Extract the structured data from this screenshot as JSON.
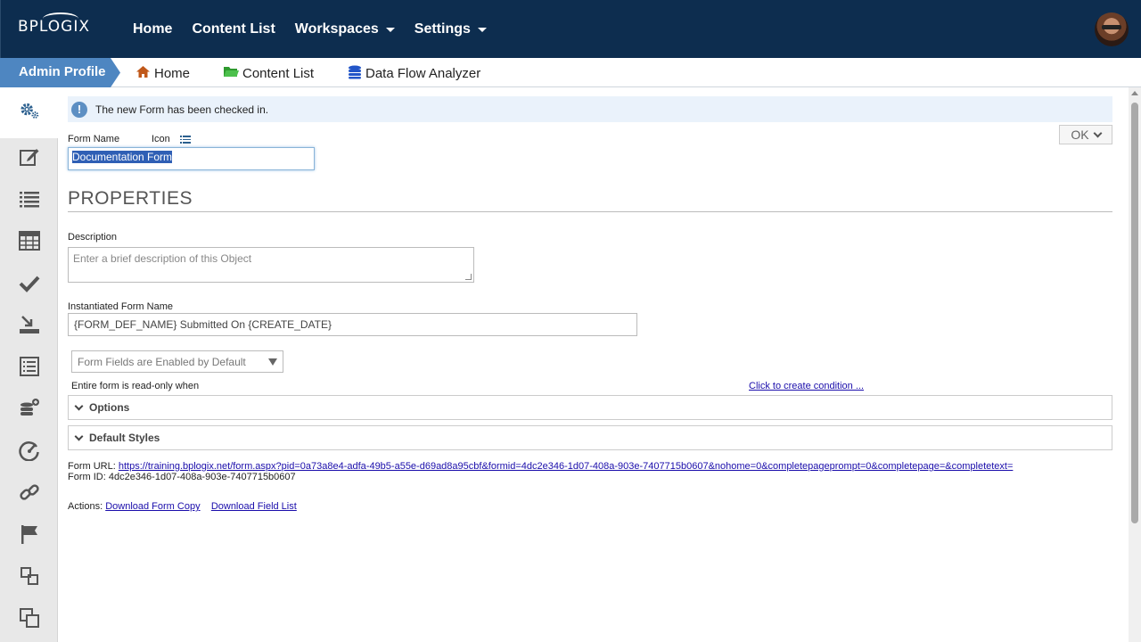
{
  "topbar": {
    "logo": "BPLOGIX",
    "nav": [
      {
        "label": "Home",
        "dropdown": false
      },
      {
        "label": "Content List",
        "dropdown": false
      },
      {
        "label": "Workspaces",
        "dropdown": true
      },
      {
        "label": "Settings",
        "dropdown": true
      }
    ],
    "avatar": "user-avatar"
  },
  "breadcrumb": {
    "active_tab": "Admin Profile",
    "items": [
      {
        "label": "Home",
        "icon": "house-icon",
        "color": "#c0581a"
      },
      {
        "label": "Content List",
        "icon": "folder-icon",
        "color": "#2e9a2e"
      },
      {
        "label": "Data Flow Analyzer",
        "icon": "database-icon",
        "color": "#2255c8"
      }
    ]
  },
  "sidebar": {
    "items": [
      "gears-icon",
      "edit-icon",
      "list-icon",
      "table-icon",
      "check-icon",
      "import-icon",
      "form-list-icon",
      "database-add-icon",
      "gauge-icon",
      "link-icon",
      "flag-icon",
      "layers-icon",
      "copy-icon"
    ]
  },
  "alert": {
    "text": "The new Form has been checked in."
  },
  "ok_button": "OK",
  "form": {
    "name_label": "Form Name",
    "icon_label": "Icon",
    "name_value": "Documentation Form",
    "section_title": "PROPERTIES",
    "description_label": "Description",
    "description_placeholder": "Enter a brief description of this Object",
    "instantiated_label": "Instantiated Form Name",
    "instantiated_value": "{FORM_DEF_NAME} Submitted On {CREATE_DATE}",
    "fields_select": "Form Fields are Enabled by Default",
    "readonly_label": "Entire form is read-only when",
    "condition_link": "Click to create condition ...",
    "options_label": "Options",
    "default_styles_label": "Default Styles",
    "url_label": "Form URL:",
    "url_value": "https://training.bplogix.net/form.aspx?pid=0a73a8e4-adfa-49b5-a55e-d69ad8a95cbf&formid=4dc2e346-1d07-408a-903e-7407715b0607&nohome=0&completepageprompt=0&completepage=&completetext=",
    "id_label": "Form ID:",
    "id_value": "4dc2e346-1d07-408a-903e-7407715b0607",
    "actions_label": "Actions:",
    "download_copy": "Download Form Copy",
    "download_fields": "Download Field List"
  }
}
